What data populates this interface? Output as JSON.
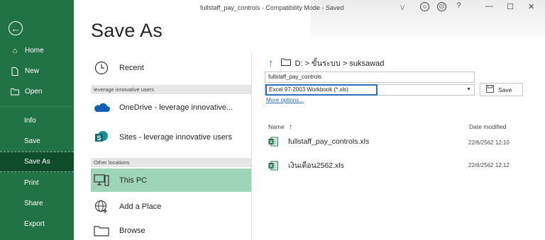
{
  "titlebar": {
    "title": "fullstaff_pay_controls  -  Compatibility Mode  -  Saved",
    "user_initial": "V",
    "minimize": "—",
    "restore": "☐",
    "close": "✕"
  },
  "nav": {
    "back_label": "←",
    "items": [
      {
        "label": "Home",
        "icon": "home-icon"
      },
      {
        "label": "New",
        "icon": "new-document-icon"
      },
      {
        "label": "Open",
        "icon": "open-folder-icon"
      },
      {
        "label": "Info"
      },
      {
        "label": "Save"
      },
      {
        "label": "Save As"
      },
      {
        "label": "Print"
      },
      {
        "label": "Share"
      },
      {
        "label": "Export"
      }
    ]
  },
  "heading": "Save As",
  "locations": {
    "recent": "Recent",
    "section_org": "leverage innovative users",
    "onedrive": "OneDrive - leverage innovative...",
    "sites": "Sites - leverage innovative users",
    "section_other": "Other locations",
    "this_pc": "This PC",
    "add_place": "Add a Place",
    "browse": "Browse"
  },
  "save_pane": {
    "path": "D: > ขั้นระบบ > suksawad",
    "filename": "fullstaff_pay_controls",
    "filetype": "Excel 97-2003 Workbook (*.xls)",
    "save_label": "Save",
    "more_options": "More options...",
    "col_name": "Name",
    "col_date": "Date modified",
    "files": [
      {
        "name": "fullstaff_pay_controls.xls",
        "date": "22/6/2562 12:10"
      },
      {
        "name": "เงินเดือน2562.xls",
        "date": "22/6/2562 12:12"
      }
    ]
  },
  "colors": {
    "nav_bg": "#217346",
    "nav_active": "#0f4d2b",
    "selected_location": "#9fd5b7",
    "focus_blue": "#2b6fbf"
  }
}
